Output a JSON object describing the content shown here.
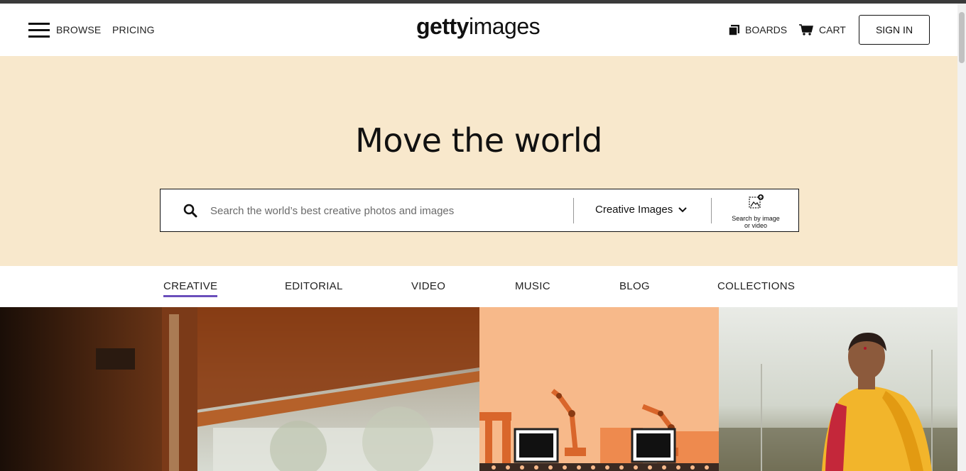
{
  "header": {
    "browse_label": "BROWSE",
    "pricing_label": "PRICING",
    "logo_bold": "getty",
    "logo_light": "images",
    "boards_label": "BOARDS",
    "cart_label": "CART",
    "signin_label": "SIGN IN"
  },
  "hero": {
    "title": "Move the world",
    "search_placeholder": "Search the world’s best creative photos and images",
    "search_value": "",
    "type_selected": "Creative Images",
    "image_search_line1": "Search by image",
    "image_search_line2": "or video"
  },
  "tabs": [
    {
      "label": "CREATIVE",
      "active": true
    },
    {
      "label": "EDITORIAL",
      "active": false
    },
    {
      "label": "VIDEO",
      "active": false
    },
    {
      "label": "MUSIC",
      "active": false
    },
    {
      "label": "BLOG",
      "active": false
    },
    {
      "label": "COLLECTIONS",
      "active": false
    }
  ],
  "colors": {
    "hero_bg": "#f8e8cc",
    "active_tab_underline": "#6b4fbb",
    "illustration_bg": "#f7b98a"
  },
  "icons": [
    "hamburger-icon",
    "boards-icon",
    "cart-icon",
    "search-icon",
    "chevron-down-icon",
    "image-search-icon"
  ]
}
